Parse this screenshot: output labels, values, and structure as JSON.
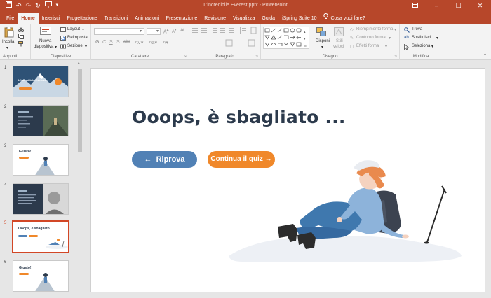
{
  "window": {
    "title": "L'incredibile Everest.pptx  -  PowerPoint"
  },
  "tabs": [
    {
      "label": "File"
    },
    {
      "label": "Home"
    },
    {
      "label": "Inserisci"
    },
    {
      "label": "Progettazione"
    },
    {
      "label": "Transizioni"
    },
    {
      "label": "Animazioni"
    },
    {
      "label": "Presentazione"
    },
    {
      "label": "Revisione"
    },
    {
      "label": "Visualizza"
    },
    {
      "label": "Guida"
    },
    {
      "label": "iSpring Suite 10"
    }
  ],
  "tell_me": "Cosa vuoi fare?",
  "ribbon": {
    "appunti": {
      "paste": "Incolla",
      "label": "Appunti"
    },
    "diapositive": {
      "new_slide_1": "Nuova",
      "new_slide_2": "diapositiva",
      "layout": "Layout",
      "reset": "Reimposta",
      "section": "Sezione",
      "label": "Diapositive"
    },
    "carattere": {
      "bold": "G",
      "italic": "C",
      "underline": "S",
      "strike": "S",
      "shadow": "abc",
      "label": "Carattere"
    },
    "paragrafo": {
      "label": "Paragrafo"
    },
    "disegno": {
      "arrange": "Disponi",
      "quick_styles_1": "Stili",
      "quick_styles_2": "veloci",
      "fill": "Riempimento forma",
      "outline": "Contorno forma",
      "effects": "Effetti forma",
      "label": "Disegno"
    },
    "modifica": {
      "find": "Trova",
      "replace": "Sostituisci",
      "select": "Seleziona",
      "label": "Modifica"
    }
  },
  "thumbnails": [
    {
      "number": "1",
      "title": "L'incredibile Everest"
    },
    {
      "number": "2",
      "title": ""
    },
    {
      "number": "3",
      "title": "Giusto!"
    },
    {
      "number": "4",
      "title": ""
    },
    {
      "number": "5",
      "title": "Ooops, è sbagliato ..."
    },
    {
      "number": "6",
      "title": "Giusto!"
    }
  ],
  "slide": {
    "title": "Ooops, è sbagliato ...",
    "retry_label": "Riprova",
    "continue_label": "Continua il quiz"
  },
  "colors": {
    "accent": "#b7472a",
    "retry": "#5181b5",
    "continue": "#f0882a",
    "title_text": "#2c3a4c",
    "selected_thumb": "#d24726"
  }
}
